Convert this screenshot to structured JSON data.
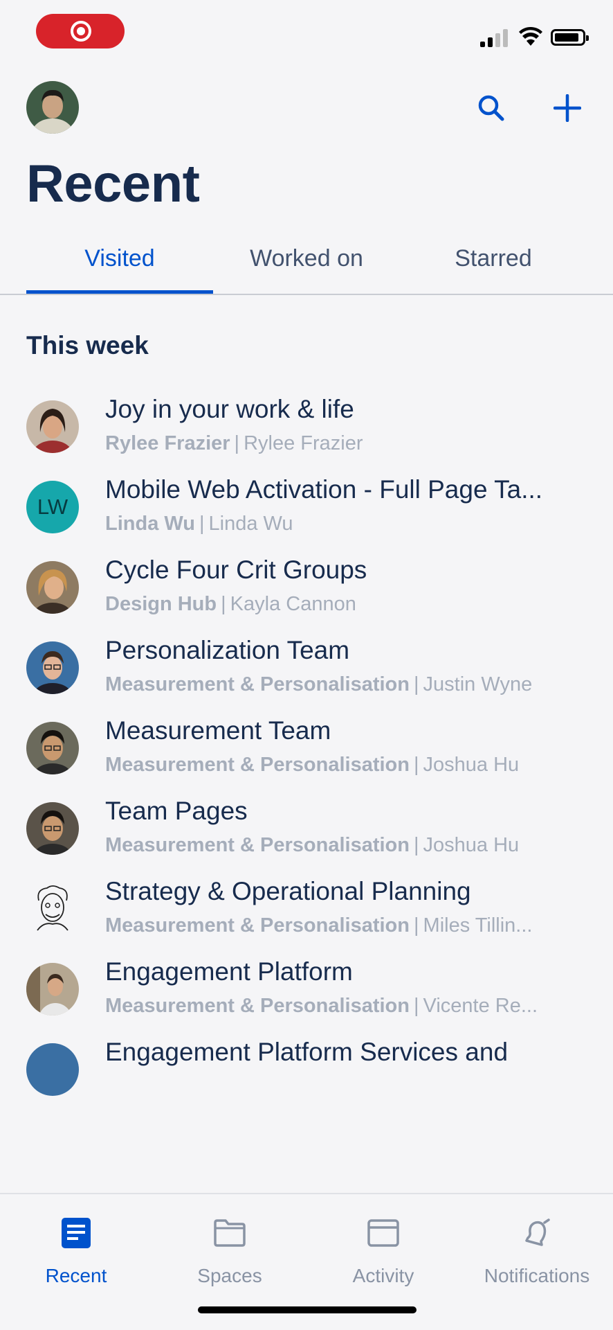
{
  "status_bar": {
    "record_icon": "screen-record-icon",
    "signal_icon": "cellular-signal-icon",
    "wifi_icon": "wifi-icon",
    "battery_icon": "battery-icon"
  },
  "header": {
    "profile_icon": "profile-avatar",
    "search_icon": "search-icon",
    "create_icon": "plus-icon",
    "title": "Recent"
  },
  "tabs": [
    {
      "label": "Visited",
      "active": true
    },
    {
      "label": "Worked on",
      "active": false
    },
    {
      "label": "Starred",
      "active": false
    }
  ],
  "section": {
    "heading": "This week"
  },
  "items": [
    {
      "title": "Joy in your work & life",
      "space": "Rylee Frazier",
      "author": "Rylee Frazier",
      "avatar_color": "#6d4a3e"
    },
    {
      "title": "Mobile Web Activation - Full Page Ta...",
      "space": "Linda Wu",
      "author": "Linda Wu",
      "initials": "LW",
      "avatar_color": "#16a7ab"
    },
    {
      "title": "Cycle Four Crit Groups",
      "space": "Design Hub",
      "author": "Kayla Cannon",
      "avatar_color": "#c69a6a"
    },
    {
      "title": "Personalization Team",
      "space": "Measurement & Personalisation",
      "author": "Justin Wyne",
      "avatar_color": "#3a6fa3"
    },
    {
      "title": "Measurement Team",
      "space": "Measurement & Personalisation",
      "author": "Joshua Hu",
      "avatar_color": "#5b4a3a"
    },
    {
      "title": "Team Pages",
      "space": "Measurement & Personalisation",
      "author": "Joshua Hu",
      "avatar_color": "#4d4136"
    },
    {
      "title": "Strategy & Operational Planning",
      "space": "Measurement & Personalisation",
      "author": "Miles Tillin...",
      "avatar_color": "#ffffff"
    },
    {
      "title": "Engagement Platform",
      "space": "Measurement & Personalisation",
      "author": "Vicente Re...",
      "avatar_color": "#8a7a66"
    },
    {
      "title": "Engagement Platform Services and",
      "space": "",
      "author": "",
      "avatar_color": "#3a6fa3"
    }
  ],
  "bottom_nav": [
    {
      "label": "Recent",
      "icon": "recent-doc-icon",
      "active": true
    },
    {
      "label": "Spaces",
      "icon": "folder-icon",
      "active": false
    },
    {
      "label": "Activity",
      "icon": "activity-icon",
      "active": false
    },
    {
      "label": "Notifications",
      "icon": "bell-icon",
      "active": false
    }
  ],
  "colors": {
    "accent": "#0052cc",
    "text_primary": "#172b4d",
    "text_secondary": "#a5adba",
    "background": "#f5f5f7",
    "record_red": "#d8232a"
  }
}
